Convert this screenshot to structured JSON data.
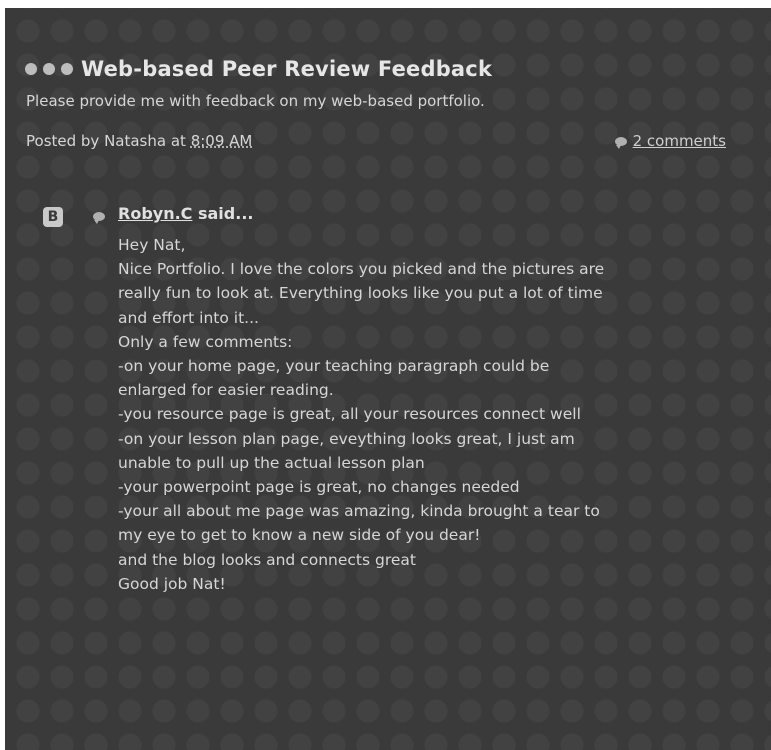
{
  "post": {
    "title": "Web-based Peer Review Feedback",
    "body": "Please provide me with feedback on my web-based portfolio.",
    "posted_by_prefix": "Posted by Natasha at ",
    "time": "8:09 AM",
    "comments_link": "2 comments"
  },
  "comment": {
    "author": "Robyn.C",
    "said": " said...",
    "lines": [
      "Hey Nat,",
      "Nice Portfolio. I love the colors you picked and the pictures are",
      "really fun to look at. Everything looks like you put a lot of time",
      "and effort into it...",
      "Only a few comments:",
      "-on your home page, your teaching paragraph could be",
      "enlarged for easier reading.",
      "-you resource page is great, all your resources connect well",
      "-on your lesson plan page, eveything looks great, I just am",
      "unable to pull up the actual lesson plan",
      "-your powerpoint page is great, no changes needed",
      "-your all about me page was amazing, kinda brought a tear to",
      "my eye to get to know a new side of you dear!",
      "and the blog looks and connects great",
      "Good job Nat!"
    ]
  },
  "icons": {
    "blogger_glyph": "B",
    "header_dots": [
      "dot",
      "dot",
      "dot"
    ]
  },
  "colors": {
    "background": "#3a3a3a",
    "text": "#d6d6d6",
    "title": "#e6e6e6",
    "dots": "#bdbdbd"
  }
}
